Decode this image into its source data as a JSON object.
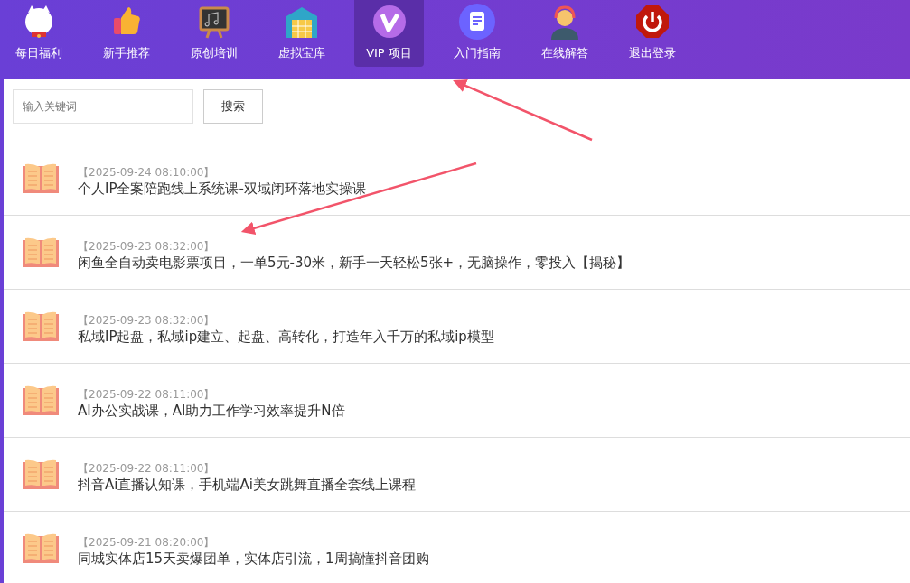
{
  "nav": [
    {
      "label": "每日福利",
      "selected": false
    },
    {
      "label": "新手推荐",
      "selected": false
    },
    {
      "label": "原创培训",
      "selected": false
    },
    {
      "label": "虚拟宝库",
      "selected": false
    },
    {
      "label": "VIP 项目",
      "selected": true
    },
    {
      "label": "入门指南",
      "selected": false
    },
    {
      "label": "在线解答",
      "selected": false
    },
    {
      "label": "退出登录",
      "selected": false
    }
  ],
  "search": {
    "placeholder": "输入关键词",
    "button": "搜索"
  },
  "articles": [
    {
      "date": "【2025-09-24 08:10:00】",
      "title": "个人IP全案陪跑线上系统课-双域闭环落地实操课"
    },
    {
      "date": "【2025-09-23 08:32:00】",
      "title": "闲鱼全自动卖电影票项目，一单5元-30米，新手一天轻松5张+，无脑操作，零投入【揭秘】"
    },
    {
      "date": "【2025-09-23 08:32:00】",
      "title": "私域IP起盘，私域ip建立、起盘、高转化，打造年入千万的私域ip模型"
    },
    {
      "date": "【2025-09-22 08:11:00】",
      "title": "AI办公实战课，AI助力工作学习效率提升N倍"
    },
    {
      "date": "【2025-09-22 08:11:00】",
      "title": "抖音Ai直播认知课，手机端Ai美女跳舞直播全套线上课程"
    },
    {
      "date": "【2025-09-21 08:20:00】",
      "title": "同城实体店15天卖爆团单，实体店引流，1周搞懂抖音团购"
    }
  ]
}
